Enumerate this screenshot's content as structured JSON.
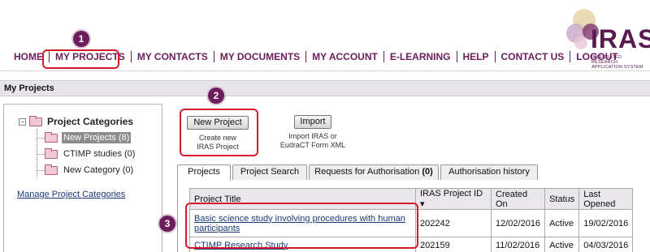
{
  "nav": {
    "items": [
      "HOME",
      "MY PROJECTS",
      "MY CONTACTS",
      "MY DOCUMENTS",
      "MY ACCOUNT",
      "E-LEARNING",
      "HELP",
      "CONTACT US",
      "LOGOUT"
    ]
  },
  "logo": {
    "word": "IRAS",
    "subtitle": "INTEGRATED RESEARCH APPLICATION SYSTEM"
  },
  "page_title": "My Projects",
  "categories": {
    "root": "Project Categories",
    "items": [
      "New Projects (8)",
      "CTIMP studies (0)",
      "New Category (0)"
    ],
    "selected_index": 0,
    "manage_link": "Manage Project Categories"
  },
  "actions": {
    "new_project": {
      "label": "New Project",
      "caption_line1": "Create new",
      "caption_line2": "IRAS Project"
    },
    "import": {
      "label": "Import",
      "caption_line1": "Import IRAS or",
      "caption_line2": "EudraCT Form XML"
    }
  },
  "tabs": [
    {
      "label": "Projects",
      "active": true
    },
    {
      "label": "Project Search",
      "active": false
    },
    {
      "label": "Requests for Authorisation ",
      "count": "(0)",
      "active": false
    },
    {
      "label": "Authorisation history",
      "active": false
    }
  ],
  "table": {
    "headers": [
      "Project Title",
      "IRAS Project ID ▾",
      "Created On",
      "Status",
      "Last Opened"
    ],
    "rows": [
      {
        "title_line1": "Basic science study involving procedures with human",
        "title_line2": "participants",
        "id": "202242",
        "created": "12/02/2016",
        "status": "Active",
        "last_opened": "19/02/2016"
      },
      {
        "title_line1": "CTIMP Research Study",
        "title_line2": "",
        "id": "202159",
        "created": "11/02/2016",
        "status": "Active",
        "last_opened": "04/03/2016"
      }
    ]
  },
  "callouts": [
    "1",
    "2",
    "3"
  ],
  "colors": {
    "brand": "#6b1d5c",
    "highlight": "#d7192d"
  }
}
